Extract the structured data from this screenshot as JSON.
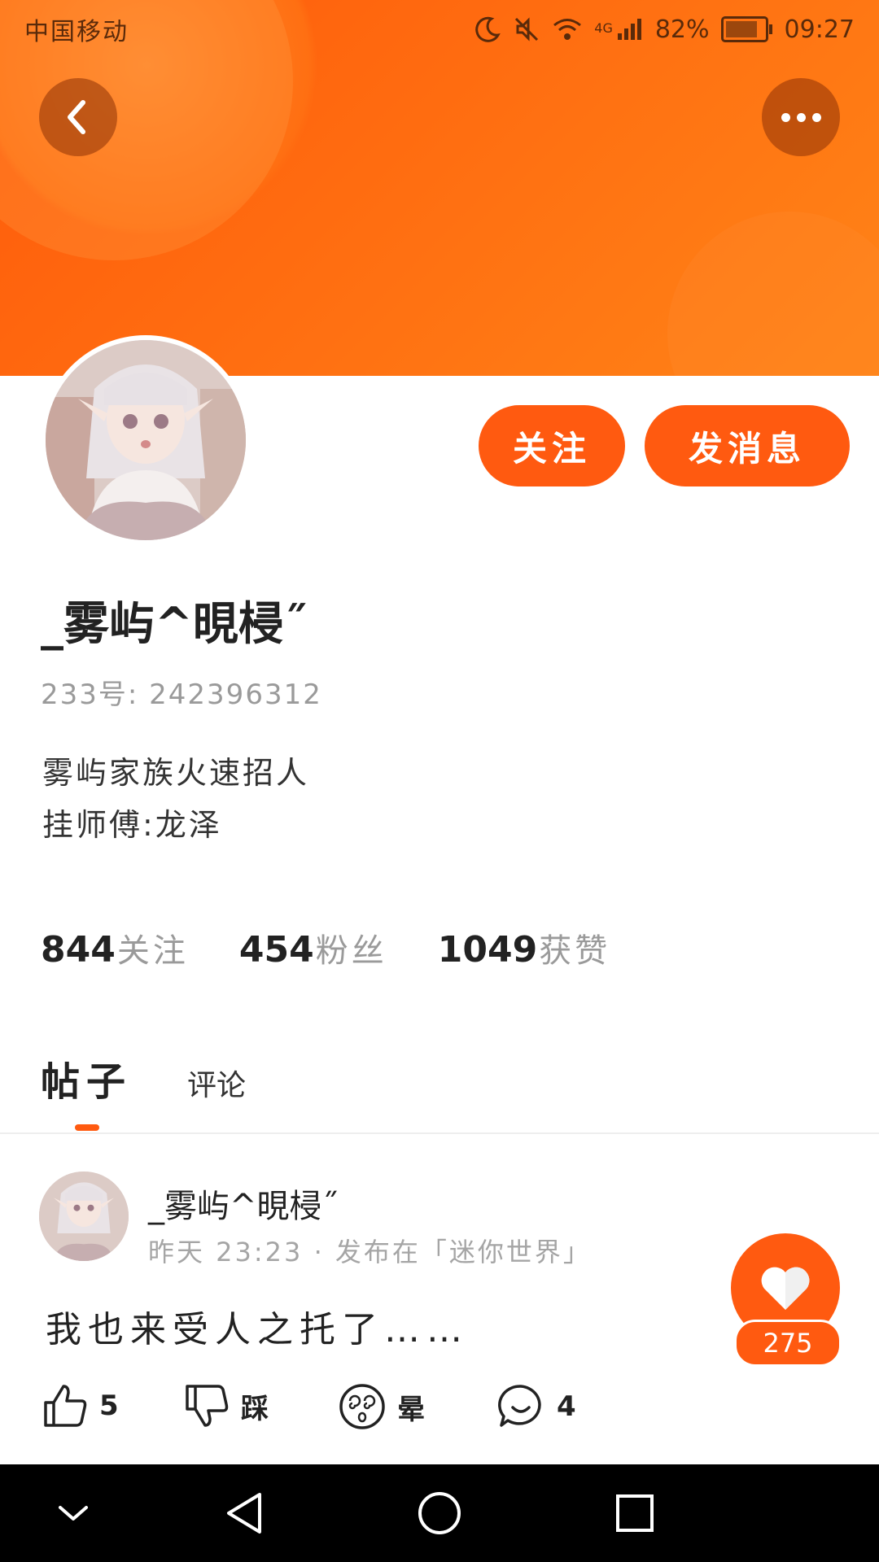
{
  "status_bar": {
    "carrier": "中国移动",
    "network": "4G",
    "battery": "82%",
    "battery_level": 0.82,
    "time": "09:27",
    "icons": [
      "moon-icon",
      "mute-icon",
      "wifi-icon",
      "signal-icon",
      "battery-icon"
    ]
  },
  "header": {
    "back_icon": "chevron-left-icon",
    "more_icon": "more-dots-icon",
    "accent_color": "#ff5a10"
  },
  "profile": {
    "follow_label": "关注",
    "message_label": "发消息",
    "username": "_雾屿^晛梫˝",
    "user_id": "233号: 242396312",
    "bio_lines": [
      "雾屿家族火速招人",
      "挂师傅:龙泽"
    ],
    "stats": [
      {
        "value": "844",
        "label": "关注"
      },
      {
        "value": "454",
        "label": "粉丝"
      },
      {
        "value": "1049",
        "label": "获赞"
      }
    ]
  },
  "tabs": [
    {
      "label": "帖子",
      "active": true
    },
    {
      "label": "评论",
      "active": false
    }
  ],
  "post": {
    "author": "_雾屿^晛梫˝",
    "meta": "昨天 23:23 · 发布在「迷你世界」",
    "text": "我也来受人之托了……",
    "like_count": "275",
    "actions": [
      {
        "icon": "thumbs-up-icon",
        "label": "5"
      },
      {
        "icon": "thumbs-down-icon",
        "label": "踩"
      },
      {
        "icon": "dizzy-face-icon",
        "label": "晕"
      },
      {
        "icon": "comment-icon",
        "label": "4"
      }
    ]
  },
  "nav_bar": {
    "items": [
      "collapse-icon",
      "back-triangle-icon",
      "home-circle-icon",
      "recents-square-icon"
    ]
  }
}
